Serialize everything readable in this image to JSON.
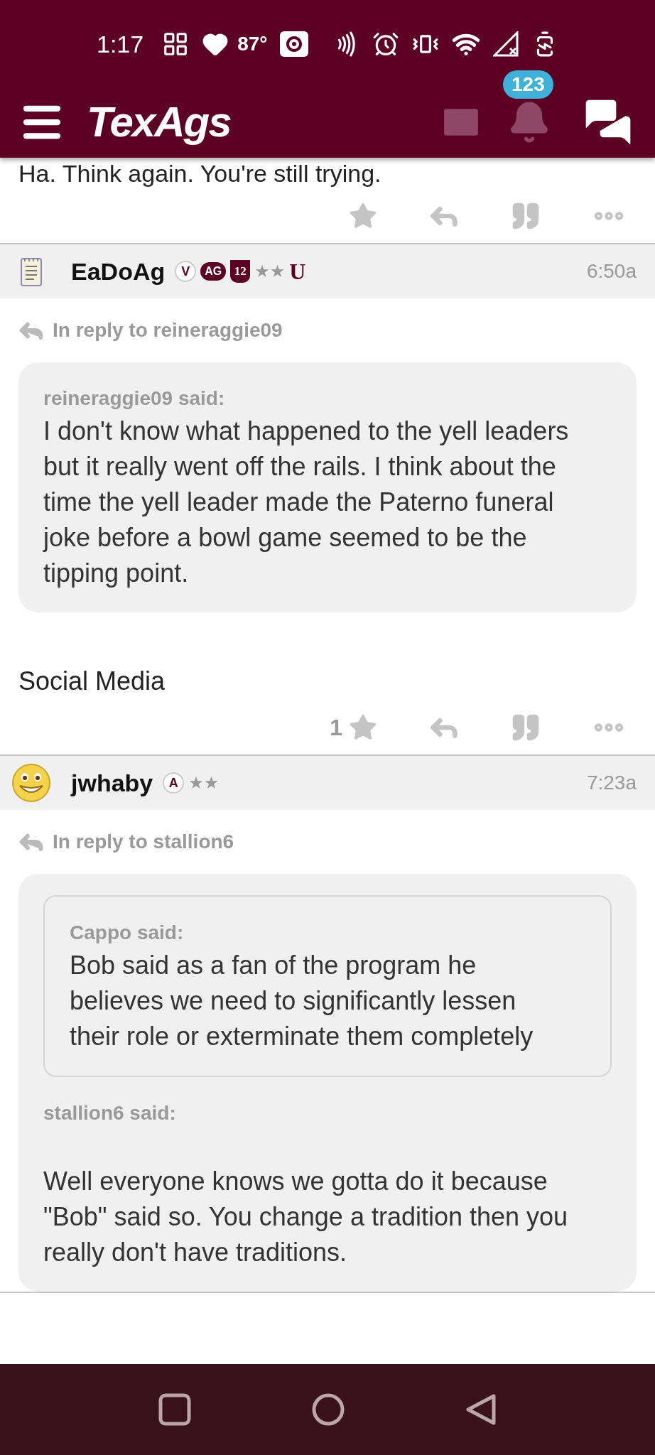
{
  "status_bar": {
    "time": "1:17",
    "temperature": "87°"
  },
  "app_bar": {
    "logo": "TexAgs",
    "notification_count": "123"
  },
  "posts": [
    {
      "kind": "tail",
      "body": "Ha. Think again. You're still trying."
    },
    {
      "kind": "full",
      "avatar": {
        "kind": "notepad"
      },
      "author": "EaDoAg",
      "badges": [
        {
          "kind": "circle",
          "text": "V"
        },
        {
          "kind": "pill",
          "text": "AG"
        },
        {
          "kind": "shield",
          "text": "12"
        },
        {
          "kind": "stars",
          "text": "★★"
        },
        {
          "kind": "letter",
          "text": "U"
        }
      ],
      "time": "6:50a",
      "reply_to": "In reply to reineraggie09",
      "quote": {
        "said": "reineraggie09 said:",
        "body": "I don't know what happened to the yell leaders but it really went off the rails. I think about the time the yell leader made the Paterno funeral joke before a bowl game seemed to be the tipping point."
      },
      "body": "Social Media",
      "star_count": "1"
    },
    {
      "kind": "full",
      "avatar": {
        "kind": "smiley"
      },
      "author": "jwhaby",
      "badges": [
        {
          "kind": "circle",
          "text": "A"
        },
        {
          "kind": "stars",
          "text": "★★"
        }
      ],
      "time": "7:23a",
      "reply_to": "In reply to stallion6",
      "quote": {
        "inner": {
          "said": "Cappo said:",
          "body": "Bob said as a fan of the program he believes we need to significantly lessen their role or exterminate them completely"
        },
        "said": "stallion6 said:",
        "body": "Well everyone knows we gotta do it because \"Bob\" said so. You change a tradition then you really don't have traditions."
      }
    }
  ]
}
